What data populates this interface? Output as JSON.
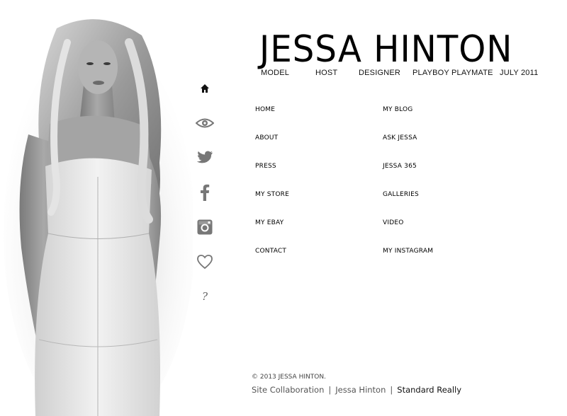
{
  "brand": {
    "name": "JESSA HINTON",
    "tagline": [
      "MODEL",
      "HOST",
      "DESIGNER",
      "PLAYBOY PLAYMATE",
      "JULY 2011"
    ]
  },
  "social_icons": [
    {
      "name": "home-icon",
      "glyph": "home"
    },
    {
      "name": "eye-icon",
      "glyph": "eye"
    },
    {
      "name": "twitter-icon",
      "glyph": "bird"
    },
    {
      "name": "facebook-icon",
      "glyph": "f"
    },
    {
      "name": "instagram-icon",
      "glyph": "camera"
    },
    {
      "name": "heart-icon",
      "glyph": "heart"
    },
    {
      "name": "question-icon",
      "glyph": "?"
    }
  ],
  "nav": {
    "left": [
      "HOME",
      "ABOUT",
      "PRESS",
      "MY STORE",
      "MY EBAY",
      "CONTACT"
    ],
    "right": [
      "MY BLOG",
      "ASK JESSA",
      "JESSA 365",
      "GALLERIES",
      "VIDEO",
      "MY INSTAGRAM"
    ]
  },
  "footer": {
    "copyright": "© 2013 JESSA HINTON.",
    "credits": [
      "Site Collaboration",
      "Jessa Hinton",
      "Standard Really"
    ],
    "separator": "|"
  },
  "colors": {
    "background": "#ffffff",
    "text": "#000000",
    "icon": "#777777"
  }
}
